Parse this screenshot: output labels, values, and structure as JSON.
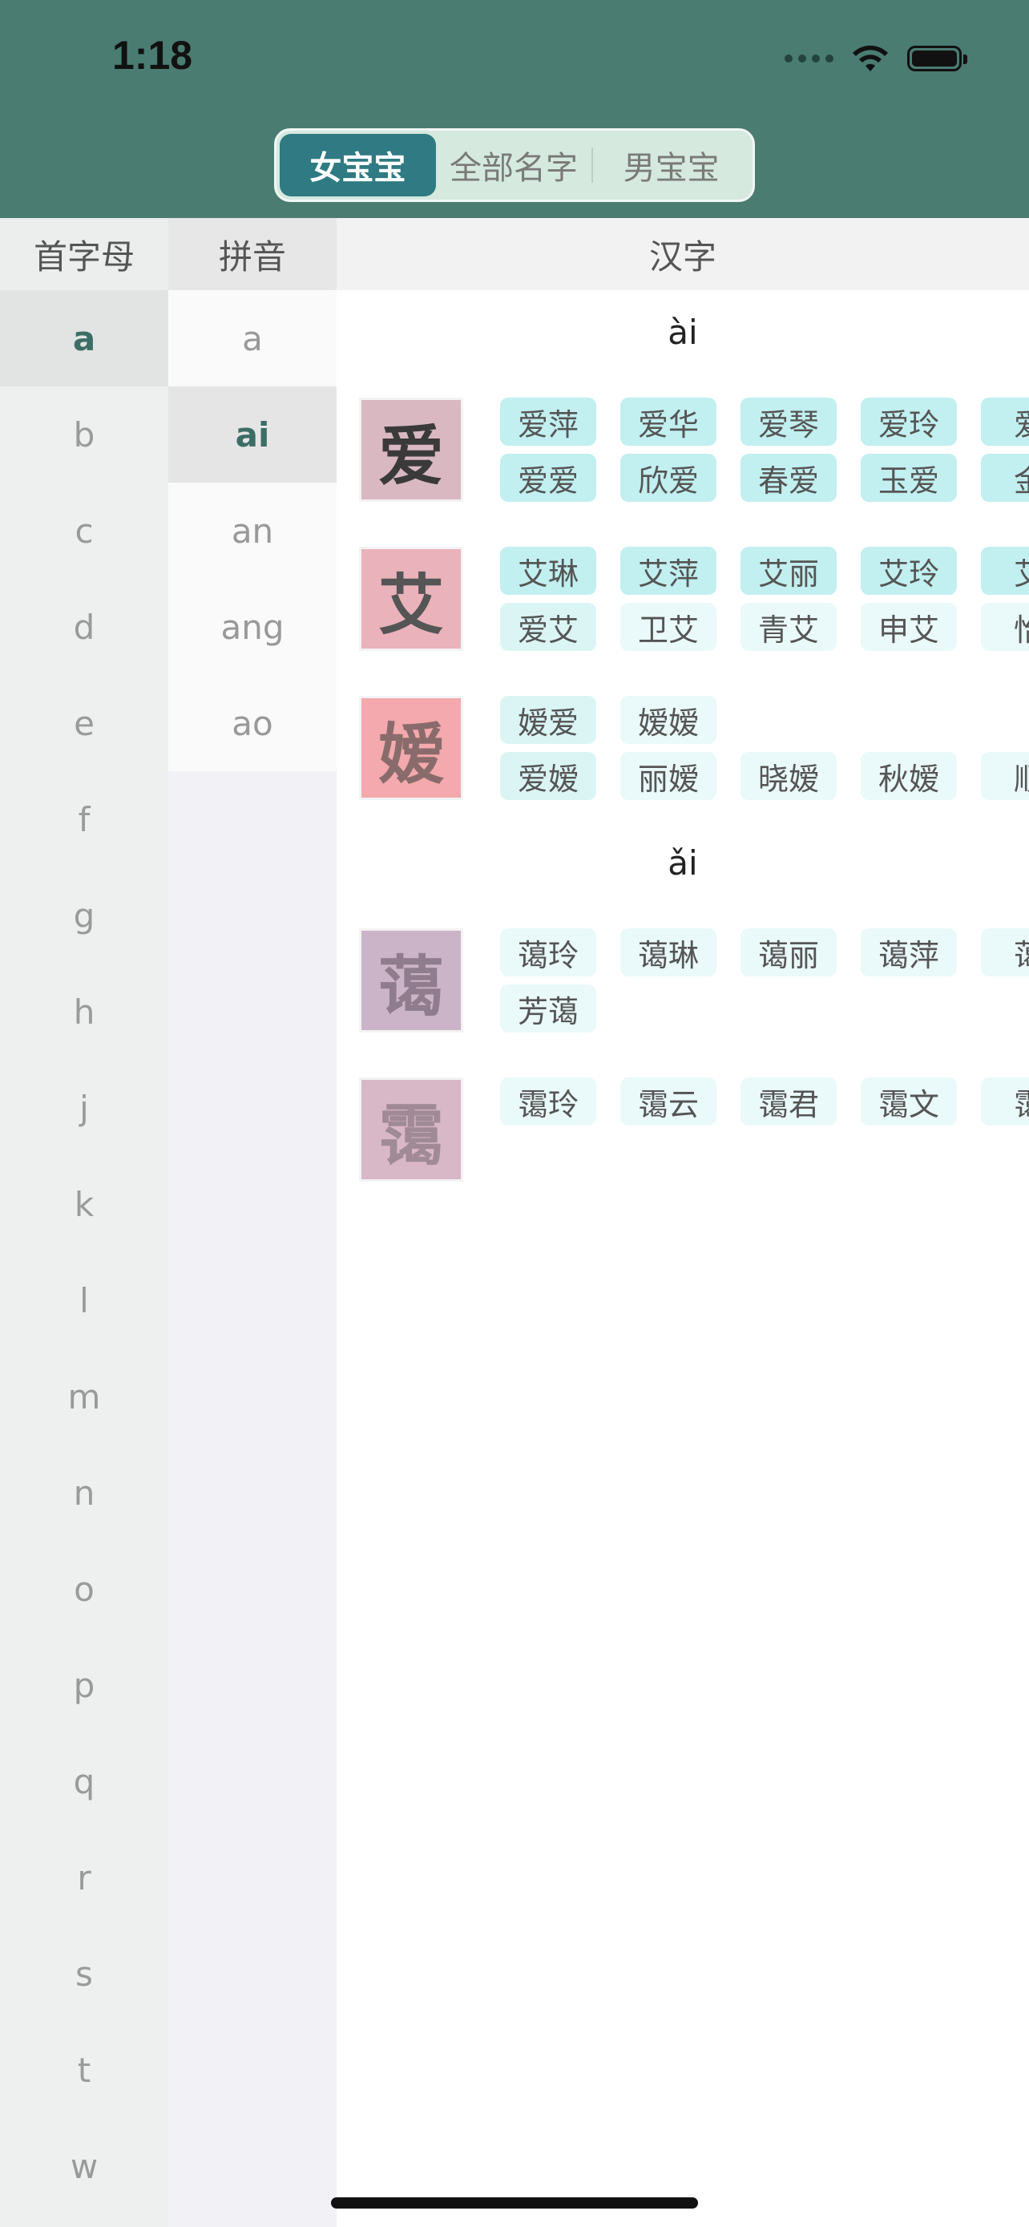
{
  "status_bar": {
    "time": "1:18"
  },
  "segmented": {
    "tabs": [
      "女宝宝",
      "全部名字",
      "男宝宝"
    ],
    "selected": "女宝宝"
  },
  "columns": {
    "initial": "首字母",
    "pinyin": "拼音",
    "hanzi": "汉字"
  },
  "letters": [
    "a",
    "b",
    "c",
    "d",
    "e",
    "f",
    "g",
    "h",
    "j",
    "k",
    "l",
    "m",
    "n",
    "o",
    "p",
    "q",
    "r",
    "s",
    "t",
    "w"
  ],
  "selected_letter": "a",
  "pinyins": [
    "a",
    "ai",
    "an",
    "ang",
    "ao"
  ],
  "selected_pinyin": "ai",
  "sections": [
    {
      "tone": "ài"
    },
    {
      "tone": "ǎi"
    }
  ],
  "characters": [
    {
      "char": "爱",
      "color": "#d9b8c2",
      "row1": [
        "爱萍",
        "爱华",
        "爱琴",
        "爱玲",
        "爱"
      ],
      "row2": [
        "爱爱",
        "欣爱",
        "春爱",
        "玉爱",
        "金"
      ]
    },
    {
      "char": "艾",
      "color": "#eab2bb",
      "row1": [
        "艾琳",
        "艾萍",
        "艾丽",
        "艾玲",
        "艾"
      ],
      "row2": [
        "爱艾",
        "卫艾",
        "青艾",
        "申艾",
        "怡"
      ]
    },
    {
      "char": "嫒",
      "color": "#f3a9ad",
      "row1": [
        "嫒爱",
        "嫒嫒"
      ],
      "row2": [
        "爱嫒",
        "丽嫒",
        "晓嫒",
        "秋嫒",
        "顺"
      ]
    },
    {
      "char": "蔼",
      "color": "#ccb4c8",
      "row1": [
        "蔼玲",
        "蔼琳",
        "蔼丽",
        "蔼萍",
        "蔼"
      ],
      "row2": [
        "芳蔼"
      ]
    },
    {
      "char": "霭",
      "color": "#d8b7c6",
      "row1": [
        "霭玲",
        "霭云",
        "霭君",
        "霭文",
        "霭"
      ],
      "row2": []
    }
  ]
}
